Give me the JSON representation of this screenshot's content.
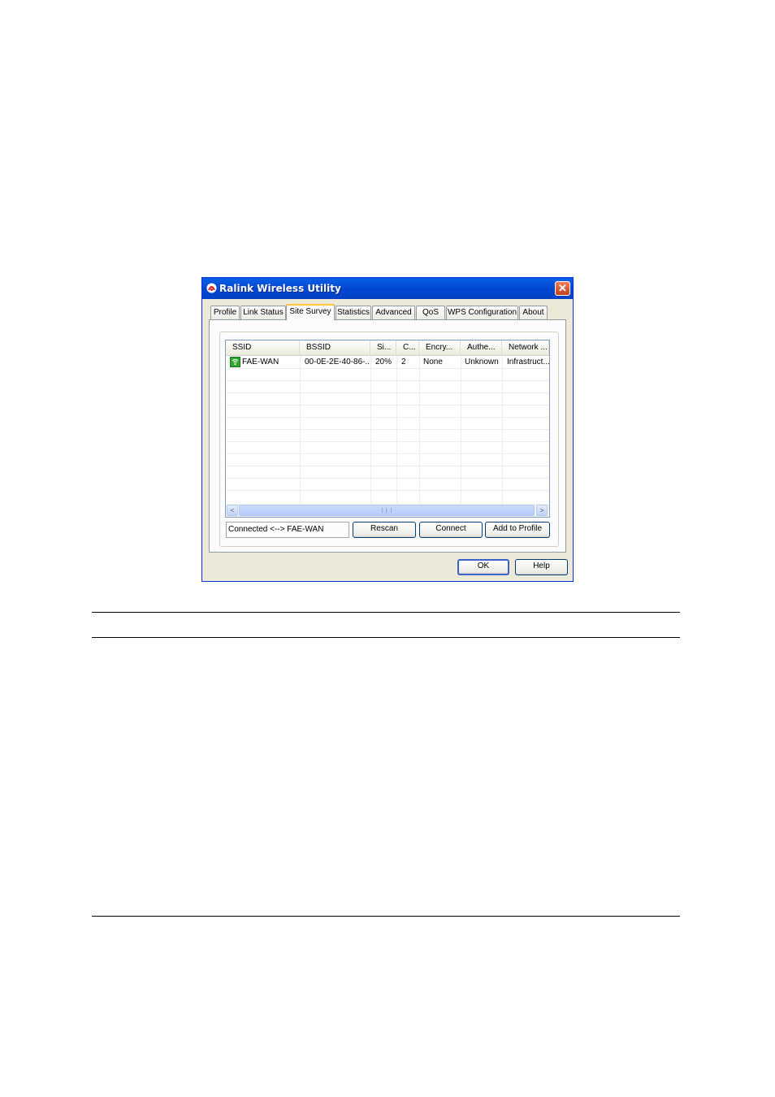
{
  "window": {
    "title": "Ralink Wireless Utility",
    "close_glyph": "✕"
  },
  "tabs": [
    {
      "label": "Profile"
    },
    {
      "label": "Link Status"
    },
    {
      "label": "Site Survey",
      "active": true
    },
    {
      "label": "Statistics"
    },
    {
      "label": "Advanced"
    },
    {
      "label": "QoS"
    },
    {
      "label": "WPS Configuration"
    },
    {
      "label": "About"
    }
  ],
  "site_survey": {
    "columns": [
      "SSID",
      "BSSID",
      "Si...",
      "C...",
      "Encry...",
      "Authe...",
      "Network ..."
    ],
    "rows": [
      {
        "ssid": "FAE-WAN",
        "bssid": "00-0E-2E-40-86-...",
        "signal": "20%",
        "channel": "2",
        "encryption": "None",
        "authentication": "Unknown",
        "network_type": "Infrastruct..."
      }
    ],
    "status_text": "Connected <--> FAE-WAN",
    "rescan_label": "Rescan",
    "connect_label": "Connect",
    "add_profile_label": "Add to Profile",
    "scroll_left_glyph": "<",
    "scroll_right_glyph": ">"
  },
  "dialog_buttons": {
    "ok_label": "OK",
    "help_label": "Help"
  },
  "icons": {
    "title_icon": "ralink-logo-icon",
    "network_icon": "wireless-network-icon"
  },
  "colors": {
    "titlebar": "#0347d0",
    "tab_highlight": "#ffc83c",
    "connected_icon": "#2ea52e"
  }
}
